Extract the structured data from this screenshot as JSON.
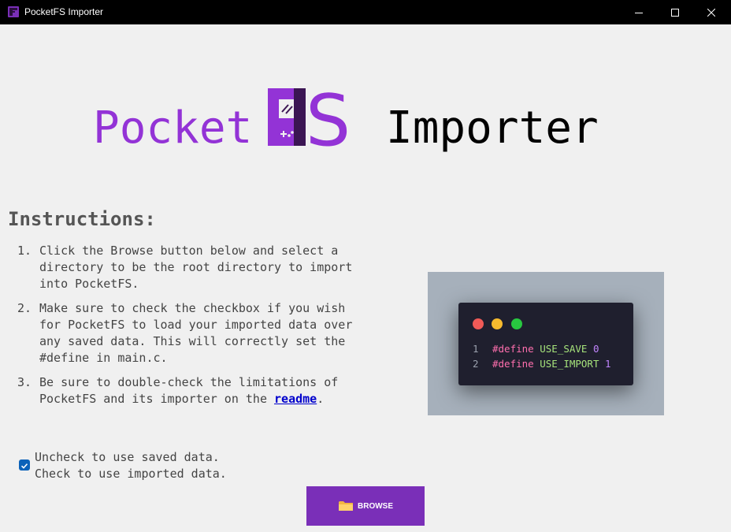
{
  "window": {
    "title": "PocketFS Importer",
    "controls": {
      "minimize": "minimize-icon",
      "maximize": "maximize-icon",
      "close": "close-icon"
    }
  },
  "logo": {
    "brand_text": "Pocket",
    "brand_mark_letters": "FS",
    "product_text": "Importer",
    "brand_color": "#9333d6"
  },
  "instructions": {
    "heading": "Instructions:",
    "steps": [
      {
        "number": "1.",
        "text": "Click the Browse button below and select a directory to be the root directory to import into PocketFS."
      },
      {
        "number": "2.",
        "text_before": "Make sure to check the checkbox if you wish for PocketFS to load your imported data over any saved data. This will correctly set the ",
        "code": "#define",
        "text_mid": " in ",
        "file": "main.c",
        "text_after": "."
      },
      {
        "number": "3.",
        "text_before": "Be sure to double-check the limitations of PocketFS and its importer on the ",
        "link": "readme",
        "text_after": "."
      }
    ]
  },
  "code_preview": {
    "lines": [
      {
        "number": "1",
        "keyword": "#define",
        "name": "USE_SAVE",
        "value": "0"
      },
      {
        "number": "2",
        "keyword": "#define",
        "name": "USE_IMPORT",
        "value": "1"
      }
    ],
    "window_dots": [
      "#f05a57",
      "#f7bb2e",
      "#28c840"
    ]
  },
  "options": {
    "checkbox_checked": true,
    "checkbox_label_line1": "Uncheck to use saved data.",
    "checkbox_label_line2": "Check to use imported data."
  },
  "actions": {
    "browse_label": "BROWSE",
    "browse_icon": "folder-icon",
    "browse_color": "#7a2fb8"
  }
}
